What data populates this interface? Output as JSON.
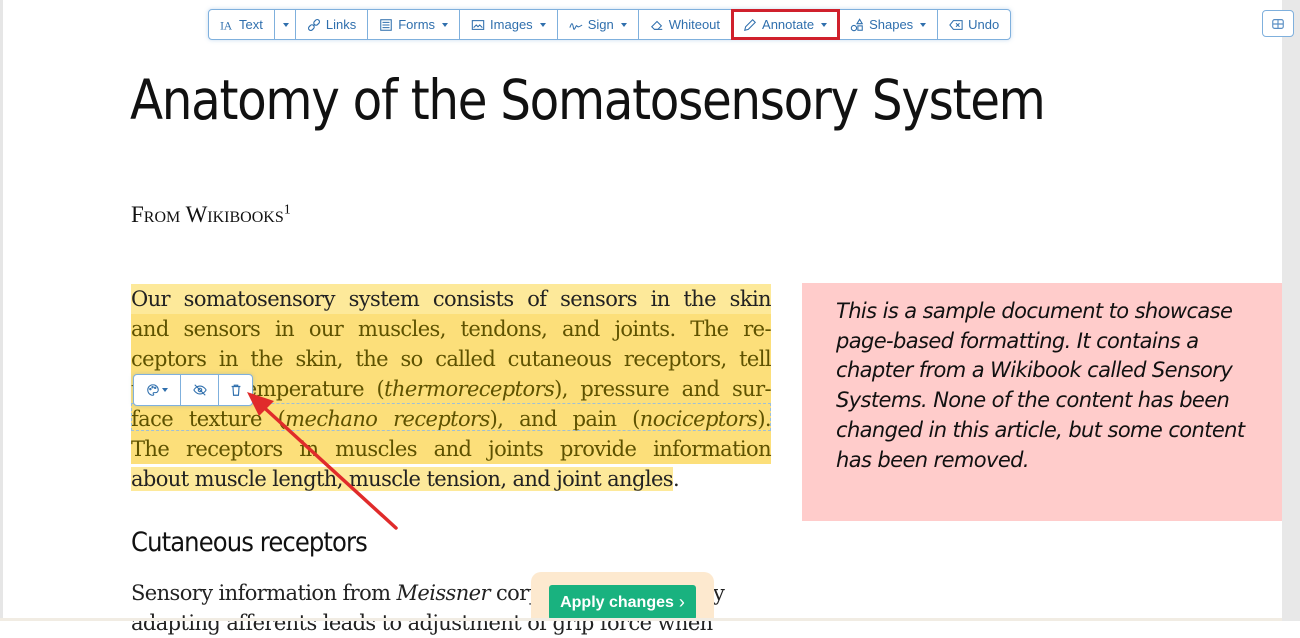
{
  "toolbar": {
    "items": [
      {
        "label": "Text",
        "icon": "text-format-icon"
      },
      {
        "label": "",
        "icon": "caret-down-icon"
      },
      {
        "label": "Links",
        "icon": "link-icon"
      },
      {
        "label": "Forms",
        "icon": "form-icon",
        "has_dropdown": true
      },
      {
        "label": "Images",
        "icon": "image-icon",
        "has_dropdown": true
      },
      {
        "label": "Sign",
        "icon": "signature-icon",
        "has_dropdown": true
      },
      {
        "label": "Whiteout",
        "icon": "eraser-icon"
      },
      {
        "label": "Annotate",
        "icon": "pencil-icon",
        "has_dropdown": true,
        "highlighted": true
      },
      {
        "label": "Shapes",
        "icon": "shapes-icon",
        "has_dropdown": true
      },
      {
        "label": "Undo",
        "icon": "undo-icon"
      }
    ],
    "sidebar_toggle_icon": "grid-icon"
  },
  "document": {
    "title": "Anatomy of the Somatosensory System",
    "subtitle": "From Wikibooks",
    "subtitle_footnote": "1",
    "paragraph1_lines": [
      [
        "Our somatosensory system consists of sensors in the skin"
      ],
      [
        "and sensors in our muscles, tendons, and joints. The re-"
      ],
      [
        "ceptors in the skin, the so called cutaneous receptors, tell"
      ],
      [
        "us about temperature (",
        "thermoreceptors",
        "), pressure and sur-"
      ],
      [
        "face texture (",
        "mechano receptors",
        "), and pain (",
        "nociceptors",
        ")."
      ],
      [
        "The receptors in muscles and joints provide information"
      ],
      [
        "about muscle length, muscle tension, and joint angles",
        "."
      ]
    ],
    "note": "This is a sample document to showcase page-based formatting. It contains a chapter from a Wikibook called Sensory Systems. None of the content has been changed in this article, but some content has been removed.",
    "section_heading": "Cutaneous receptors",
    "paragraph2_lines": [
      [
        "Sensory information from ",
        "Meissner",
        " corpuscles and rapidly"
      ],
      [
        "adapting afferents leads to adjustment of grip force when"
      ]
    ]
  },
  "annotation_toolbar": {
    "color_icon": "palette-icon",
    "hide_icon": "eye-slash-icon",
    "delete_icon": "trash-icon"
  },
  "apply_button": {
    "label": "Apply changes",
    "icon": "chevron-right-icon"
  },
  "colors": {
    "accent": "#2f6fad",
    "highlight": "#fde99a",
    "note_bg": "#ffcccb",
    "apply_green": "#19b27f",
    "annotation_arrow": "#e02b2b",
    "active_outline": "#d0202c"
  }
}
